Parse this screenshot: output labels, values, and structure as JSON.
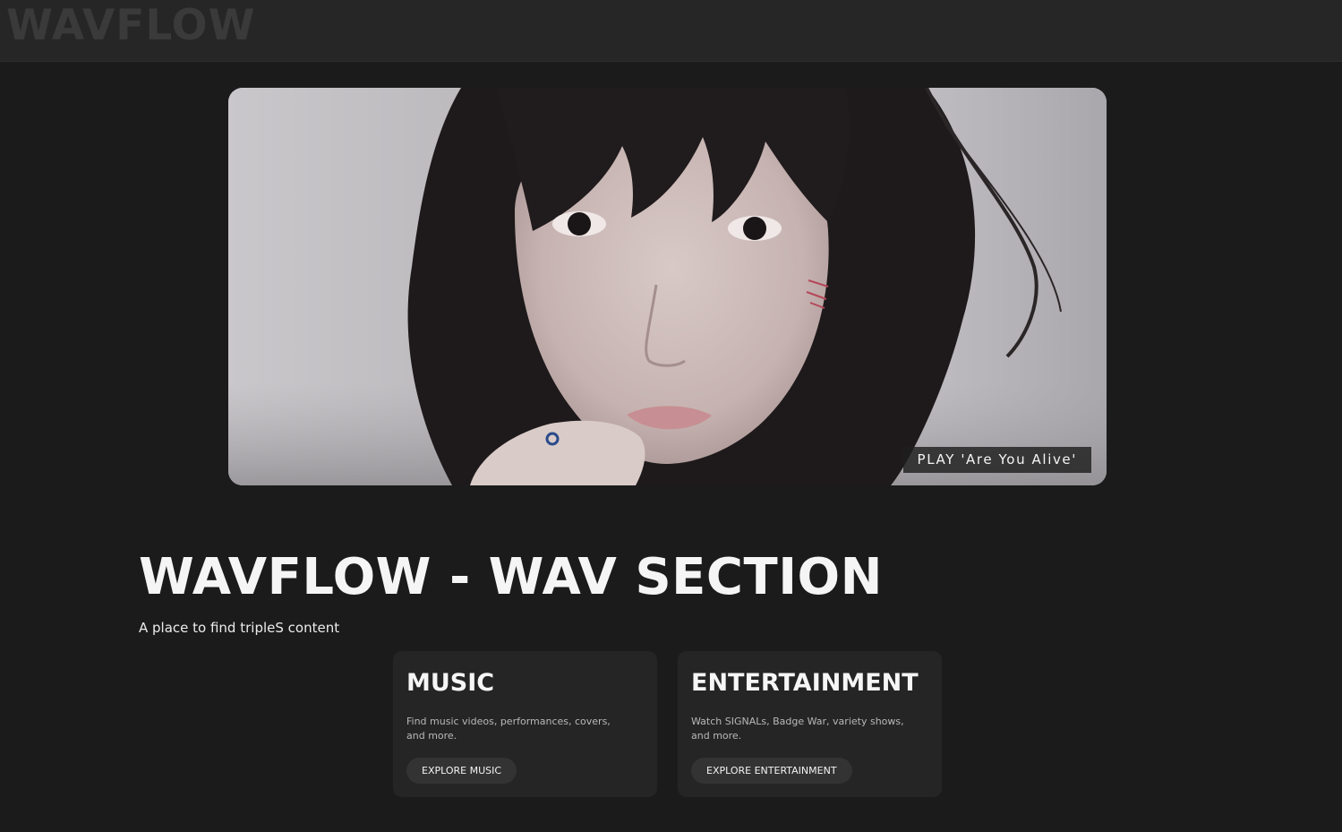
{
  "header": {
    "logo_text": "WAVFLOW"
  },
  "hero": {
    "image_description_icon": "video-thumbnail",
    "play_label": "PLAY 'Are You Alive'"
  },
  "main": {
    "title": "WAVFLOW - WAV SECTION",
    "subtitle": "A place to find tripleS content"
  },
  "cards": [
    {
      "title": "MUSIC",
      "description": "Find music videos, performances, covers, and more.",
      "button_label": "EXPLORE MUSIC"
    },
    {
      "title": "ENTERTAINMENT",
      "description": "Watch SIGNALs, Badge War, variety shows, and more.",
      "button_label": "EXPLORE ENTERTAINMENT"
    }
  ],
  "colors": {
    "page_background": "#1b1b1b",
    "header_background": "#262626",
    "card_background": "#252525",
    "button_background": "#333333",
    "logo_color": "#3a3a3a"
  }
}
